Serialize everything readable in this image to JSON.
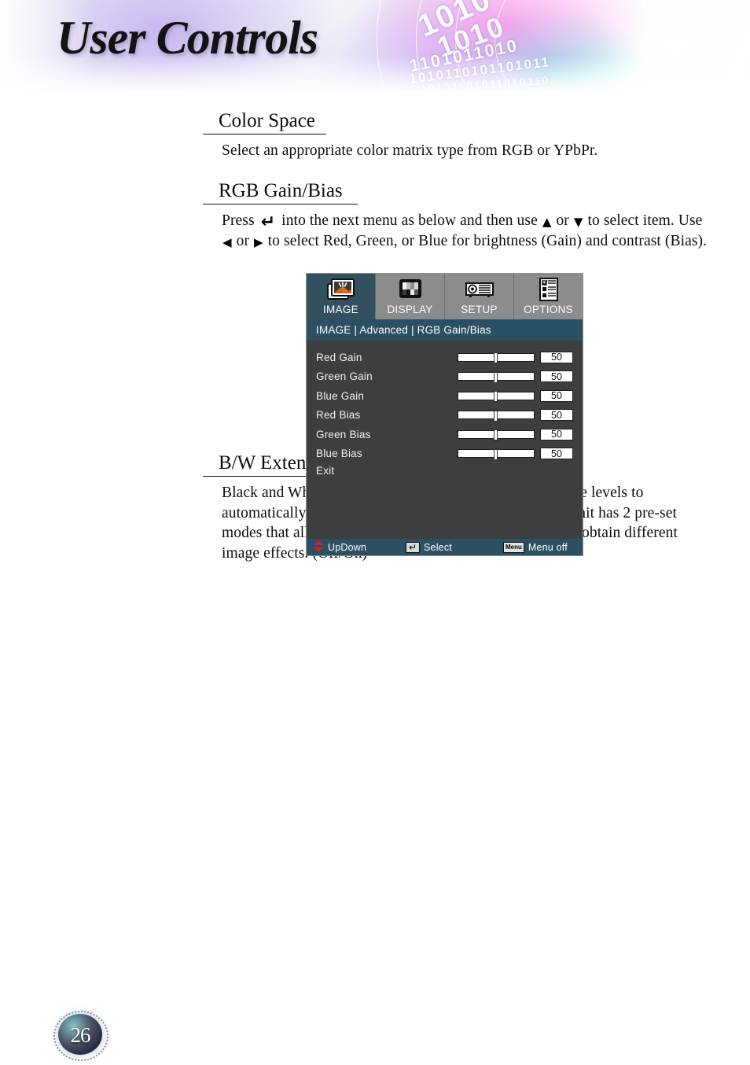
{
  "banner": {
    "title": "User Controls",
    "binary_rows": [
      "1010",
      "1010",
      "1101011010",
      "1010110101101011",
      "0101101011010110"
    ]
  },
  "sections": [
    {
      "heading": "Color Space",
      "body": "Select an appropriate color matrix type from RGB or YPbPr."
    },
    {
      "heading": "RGB Gain/Bias",
      "body_part1": "Press ",
      "body_part2": " into the next menu as below and then use ",
      "body_part3": " or ",
      "body_part4": " to select item. Use ",
      "body_part5": " or ",
      "body_part6": " to select Red, Green, or Blue for brightness (Gain) and contrast (Bias)."
    },
    {
      "heading": "B/W Extension",
      "body": "Black and White Extension can stretch the black and white levels to automatically increase the contrast of input image. This unit has 2 pre-set modes that allow the user to switch among the pre-sets to obtain different image effects. (Off/On)"
    }
  ],
  "glyphs": {
    "enter": "↵",
    "up": "▲",
    "down": "▼",
    "left": "◀",
    "right": "▶"
  },
  "osd": {
    "tabs": [
      {
        "label": "IMAGE",
        "icon": "picture-icon",
        "active": true
      },
      {
        "label": "DISPLAY",
        "icon": "monitor-testpattern-icon",
        "active": false
      },
      {
        "label": "SETUP",
        "icon": "projector-icon",
        "active": false
      },
      {
        "label": "OPTIONS",
        "icon": "checklist-icon",
        "active": false
      }
    ],
    "breadcrumb": "IMAGE | Advanced | RGB Gain/Bias",
    "rows": [
      {
        "label": "Red Gain",
        "value": "50",
        "slider_percent": 50
      },
      {
        "label": "Green Gain",
        "value": "50",
        "slider_percent": 50
      },
      {
        "label": "Blue Gain",
        "value": "50",
        "slider_percent": 50
      },
      {
        "label": "Red Bias",
        "value": "50",
        "slider_percent": 50
      },
      {
        "label": "Green Bias",
        "value": "50",
        "slider_percent": 50
      },
      {
        "label": "Blue Bias",
        "value": "50",
        "slider_percent": 50
      }
    ],
    "exit_label": "Exit",
    "footer": {
      "updown_label": "UpDown",
      "select_label": "Select",
      "menuoff_label": "Menu off",
      "enter_key_glyph": "↵",
      "menu_key_label": "Menu"
    },
    "colors": {
      "tab_active_bg": "#33505f",
      "tab_bg": "#8c8c8c",
      "breadcrumb_bg": "#2b4f63",
      "body_bg": "#3e3e3e",
      "footer_bg": "#2b4f63",
      "updown_arrow": "#e01b1b"
    }
  },
  "page": {
    "number": "26"
  }
}
